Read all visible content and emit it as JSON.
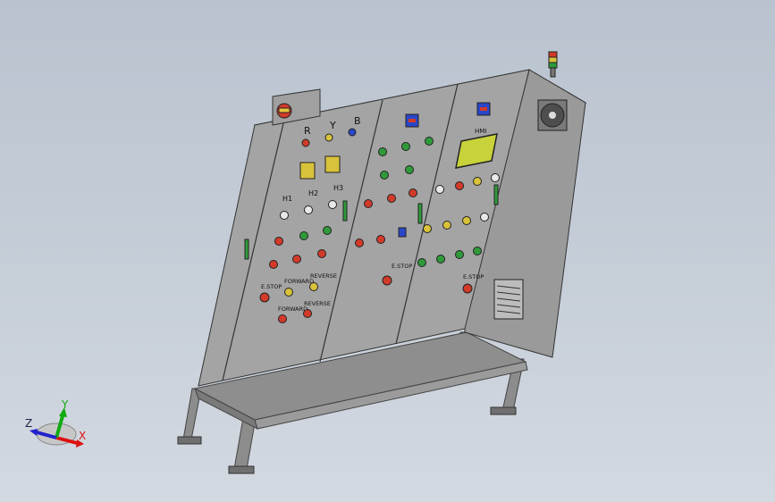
{
  "scene": {
    "panel_labels": {
      "top_strip_1": "",
      "top_strip_2": "",
      "phase_r": "R",
      "phase_y": "Y",
      "phase_b": "B",
      "selector_1": "",
      "selector_2": "",
      "hmi": "HMI",
      "small_a": "",
      "small_b": "",
      "h1": "H1",
      "h2": "H2",
      "h3": "H3",
      "estop_1": "E.STOP",
      "forward_1": "FORWARD",
      "reverse_1": "REVERSE",
      "forward_2": "FORWARD",
      "reverse_2": "REVERSE",
      "estop_2": "E.STOP",
      "estop_3": "E.STOP"
    },
    "colors": {
      "cabinet": "#9a9a9a",
      "cabinet_dark": "#6e6e6e",
      "hmi": "#c8d23a",
      "light_red": "#d23a2a",
      "light_green": "#2f9a3a",
      "light_yellow": "#d8c23a",
      "light_white": "#e8e8e8",
      "light_blue": "#2a46c8"
    }
  },
  "triad": {
    "x_label": "X",
    "y_label": "Y",
    "z_label": "Z"
  }
}
